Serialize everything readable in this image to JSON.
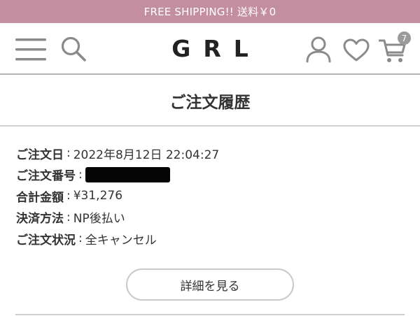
{
  "promo": {
    "text": "FREE SHIPPING!! 送料￥0"
  },
  "header": {
    "logo": "GRL",
    "icons": [
      "menu-icon",
      "search-icon",
      "user-icon",
      "heart-icon",
      "cart-icon"
    ],
    "cart_count": "7"
  },
  "page": {
    "title": "ご注文履歴"
  },
  "order": {
    "date_label": "ご注文日",
    "date_value": "2022年8月12日 22:04:27",
    "number_label": "ご注文番号",
    "total_label": "合計金額",
    "total_value": "¥31,276",
    "payment_label": "決済方法",
    "payment_value": "NP後払い",
    "status_label": "ご注文状況",
    "status_value": "全キャンセル",
    "separator": ":"
  },
  "actions": {
    "detail_label": "詳細を見る"
  },
  "colors": {
    "promo_bg": "#c48ea1",
    "icon_gray": "#8a8a8a",
    "badge_bg": "#9b9b9b"
  }
}
